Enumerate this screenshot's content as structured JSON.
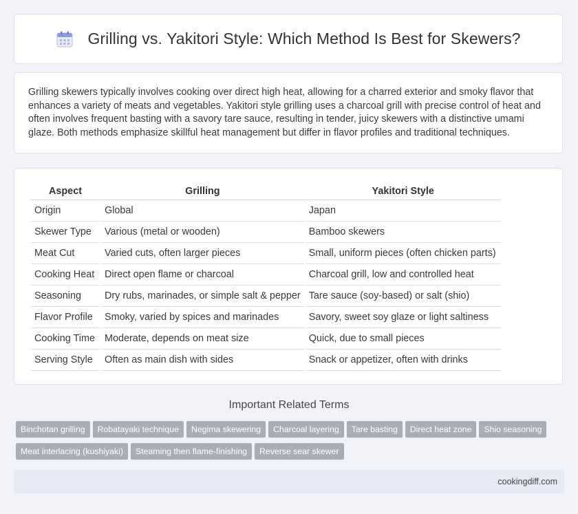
{
  "header": {
    "title": "Grilling vs. Yakitori Style: Which Method Is Best for Skewers?",
    "icon": "calendar-icon"
  },
  "intro": {
    "text": "Grilling skewers typically involves cooking over direct high heat, allowing for a charred exterior and smoky flavor that enhances a variety of meats and vegetables. Yakitori style grilling uses a charcoal grill with precise control of heat and often involves frequent basting with a savory tare sauce, resulting in tender, juicy skewers with a distinctive umami glaze. Both methods emphasize skillful heat management but differ in flavor profiles and traditional techniques."
  },
  "table": {
    "headers": [
      "Aspect",
      "Grilling",
      "Yakitori Style"
    ],
    "rows": [
      [
        "Origin",
        "Global",
        "Japan"
      ],
      [
        "Skewer Type",
        "Various (metal or wooden)",
        "Bamboo skewers"
      ],
      [
        "Meat Cut",
        "Varied cuts, often larger pieces",
        "Small, uniform pieces (often chicken parts)"
      ],
      [
        "Cooking Heat",
        "Direct open flame or charcoal",
        "Charcoal grill, low and controlled heat"
      ],
      [
        "Seasoning",
        "Dry rubs, marinades, or simple salt & pepper",
        "Tare sauce (soy-based) or salt (shio)"
      ],
      [
        "Flavor Profile",
        "Smoky, varied by spices and marinades",
        "Savory, sweet soy glaze or light saltiness"
      ],
      [
        "Cooking Time",
        "Moderate, depends on meat size",
        "Quick, due to small pieces"
      ],
      [
        "Serving Style",
        "Often as main dish with sides",
        "Snack or appetizer, often with drinks"
      ]
    ]
  },
  "related": {
    "title": "Important Related Terms",
    "tags": [
      "Binchotan grilling",
      "Robatayaki technique",
      "Negima skewering",
      "Charcoal layering",
      "Tare basting",
      "Direct heat zone",
      "Shio seasoning",
      "Meat interlacing (kushiyaki)",
      "Steaming then flame-finishing",
      "Reverse sear skewer"
    ]
  },
  "footer": {
    "site": "cookingdiff.com"
  }
}
